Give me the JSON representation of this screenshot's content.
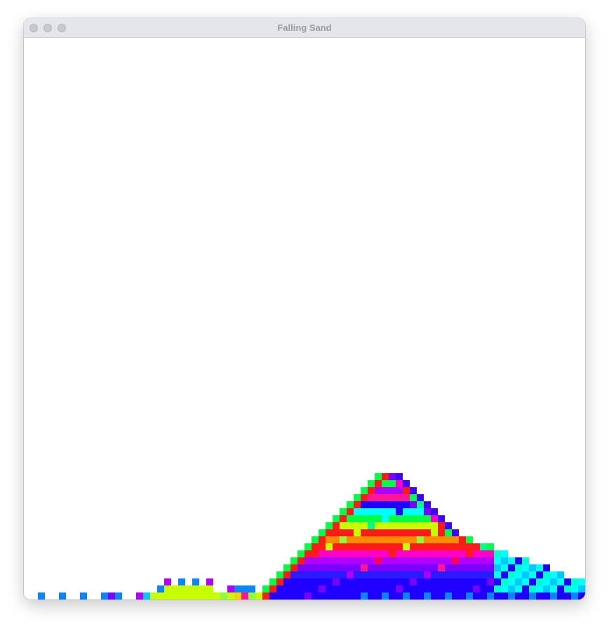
{
  "window": {
    "title": "Falling Sand"
  },
  "controls": {
    "close_icon": "close-icon",
    "minimize_icon": "minimize-icon",
    "zoom_icon": "zoom-icon"
  },
  "palette": [
    "#1f00ff",
    "#2a1aff",
    "#4000ff",
    "#7a00ff",
    "#b000ff",
    "#ff00c8",
    "#ff1493",
    "#ff0055",
    "#ff1a1a",
    "#ff8c00",
    "#ffd000",
    "#c8ff00",
    "#8cff3c",
    "#00ff44",
    "#00ff88",
    "#00ffcc",
    "#00ffff",
    "#00c8ff",
    "#0a84ff"
  ]
}
